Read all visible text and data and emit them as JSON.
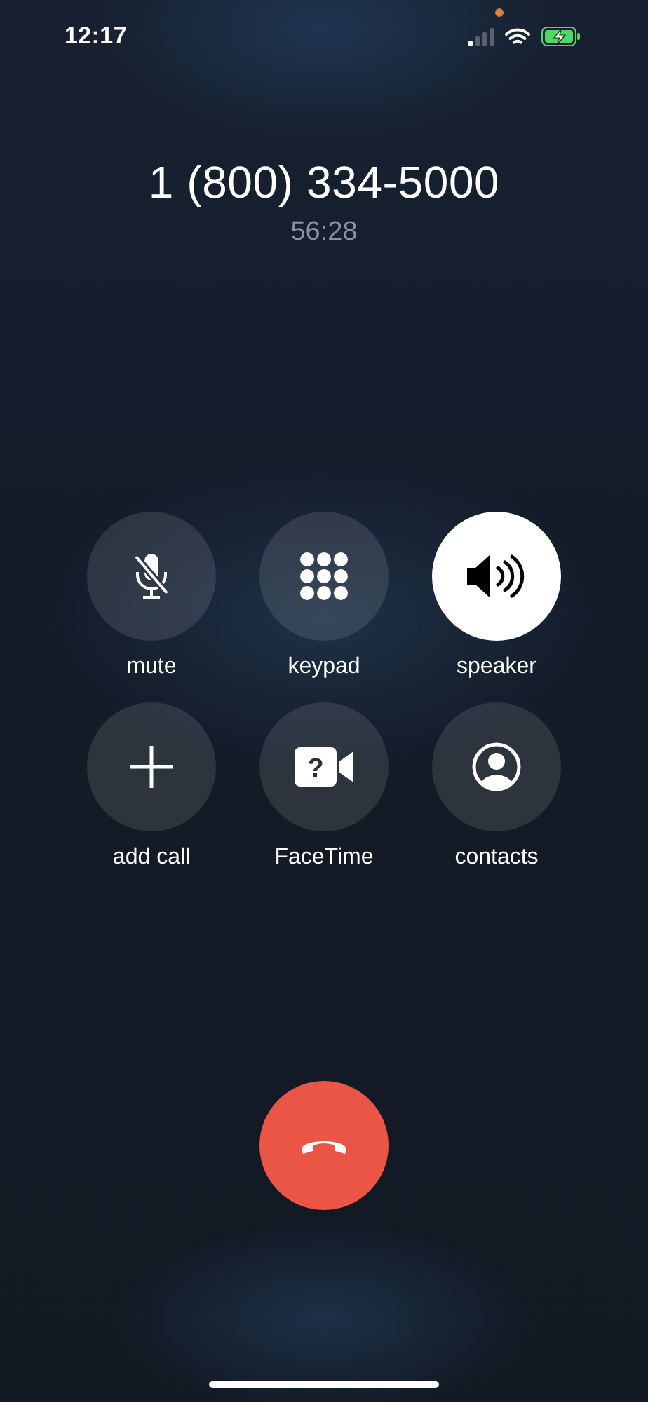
{
  "status_bar": {
    "time": "12:17",
    "mic_indicator": true,
    "battery_charging": true
  },
  "call": {
    "number": "1 (800) 334-5000",
    "duration": "56:28"
  },
  "controls": [
    {
      "kind": "mute",
      "label": "mute",
      "on": false
    },
    {
      "kind": "keypad",
      "label": "keypad",
      "on": false
    },
    {
      "kind": "speaker",
      "label": "speaker",
      "on": true
    },
    {
      "kind": "add",
      "label": "add call",
      "on": false
    },
    {
      "kind": "facetime",
      "label": "FaceTime",
      "on": false,
      "icon_glyph": "?"
    },
    {
      "kind": "contacts",
      "label": "contacts",
      "on": false
    }
  ],
  "end_call": {
    "kind": "end"
  }
}
